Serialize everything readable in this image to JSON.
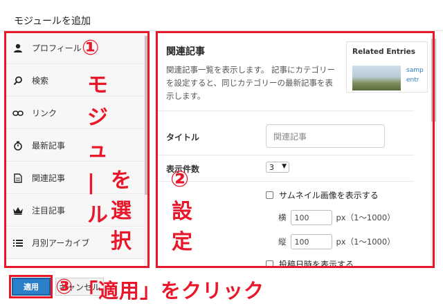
{
  "modal": {
    "title": "モジュールを追加"
  },
  "sidebar": {
    "items": [
      {
        "label": "プロフィール",
        "icon": "user-icon"
      },
      {
        "label": "検索",
        "icon": "search-icon"
      },
      {
        "label": "リンク",
        "icon": "link-icon"
      },
      {
        "label": "最新記事",
        "icon": "timer-icon"
      },
      {
        "label": "関連記事",
        "icon": "document-icon"
      },
      {
        "label": "注目記事",
        "icon": "crown-icon"
      },
      {
        "label": "月別アーカイブ",
        "icon": "list-icon"
      }
    ]
  },
  "module": {
    "title": "関連記事",
    "description": "関連記事一覧を表示します。 記事にカテゴリーを設定すると、同じカテゴリーの最新記事を表示します。",
    "preview": {
      "title": "Related Entries",
      "link1": "samp",
      "link2": "entr"
    }
  },
  "settings": {
    "title_label": "タイトル",
    "title_value": "関連記事",
    "count_label": "表示件数",
    "count_value": "3",
    "thumbnail_label": "サムネイル画像を表示する",
    "width_label": "横",
    "width_value": "100",
    "height_label": "縦",
    "height_value": "100",
    "range_text": "px（1〜1000）",
    "date_label": "投稿日時を表示する"
  },
  "footer": {
    "apply_label": "適用",
    "cancel_label": "キャンセル"
  },
  "annotations": {
    "step1_num": "①",
    "step1_text": "モジュールを選択",
    "step2_num": "②",
    "step2_text": "設定",
    "step3_num": "③",
    "step3_text": "「適用」をクリック"
  },
  "colors": {
    "accent": "#2a7fc8",
    "annotation": "#e8182a"
  }
}
